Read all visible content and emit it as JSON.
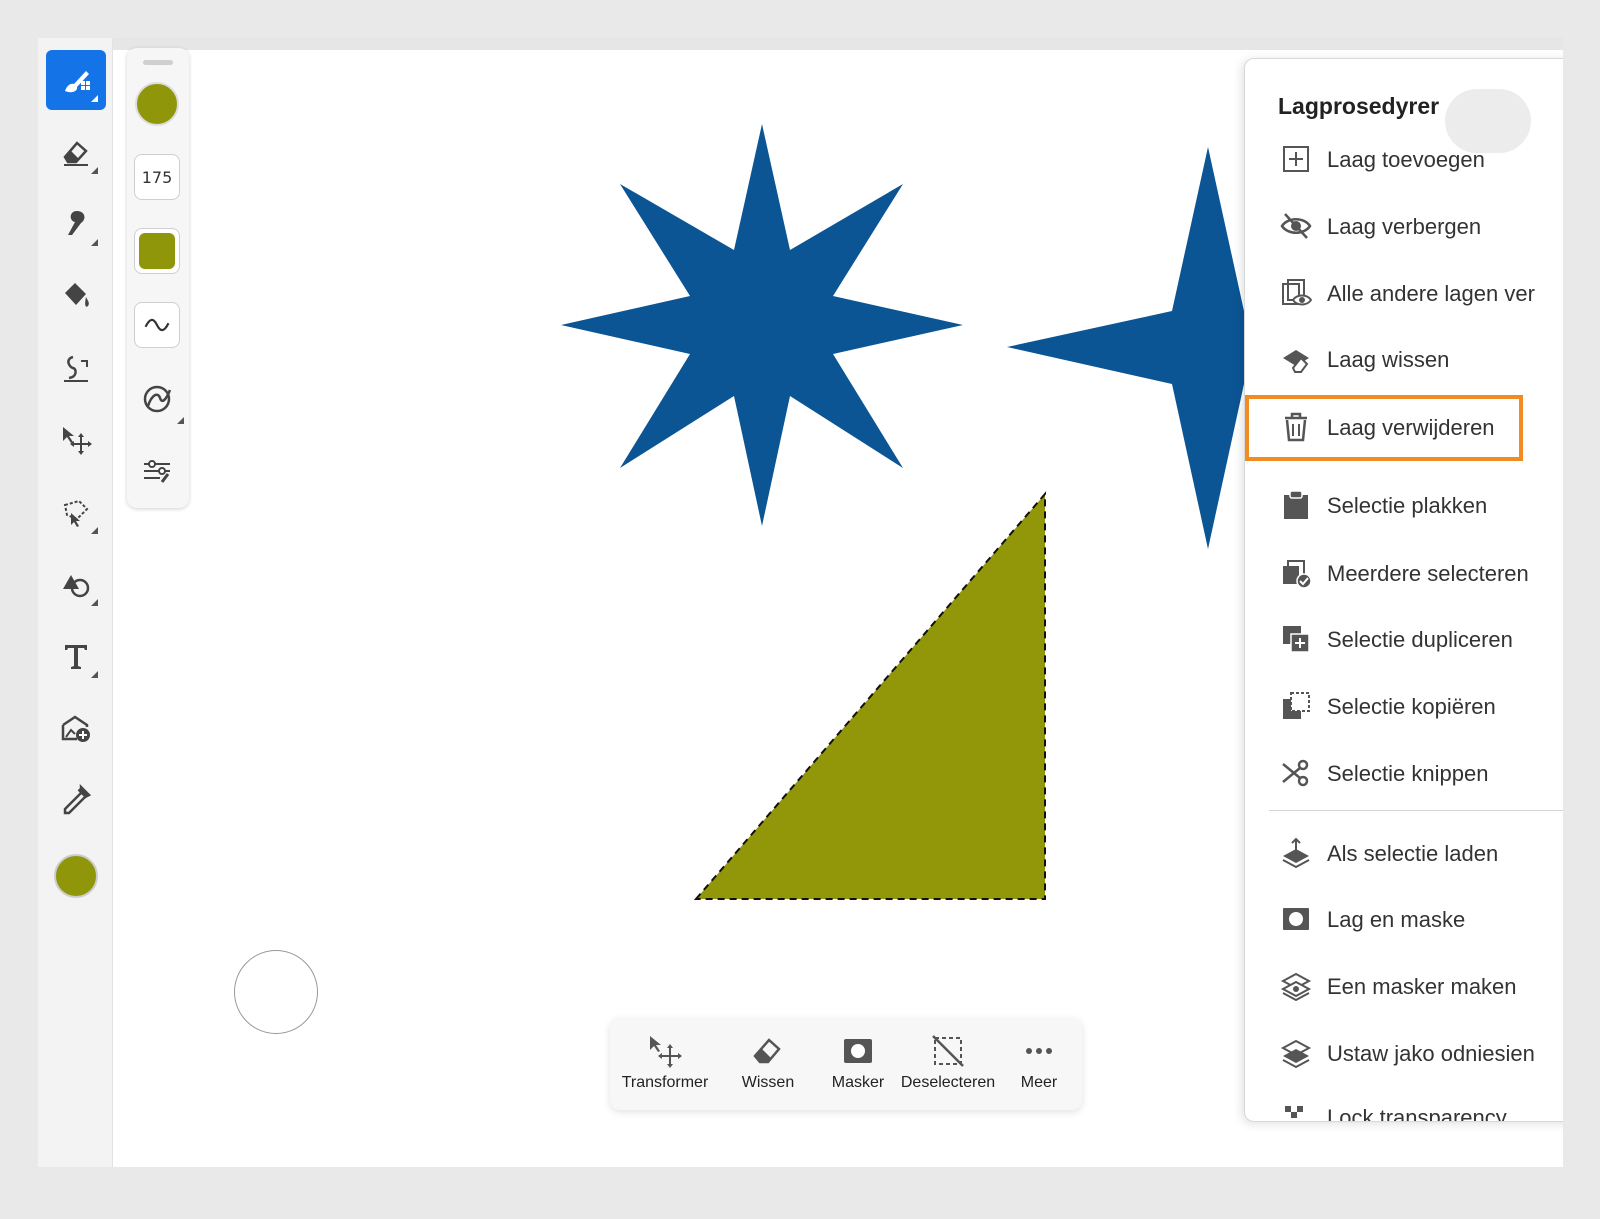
{
  "colors": {
    "active_tool": "#1473e6",
    "brush_color": "#8f9609",
    "shape_blue": "#0b5595",
    "shape_olive": "#919708",
    "highlight": "#f08c22"
  },
  "toolbar": {
    "tools": [
      {
        "name": "brush-tool-icon"
      },
      {
        "name": "eraser-tool-icon"
      },
      {
        "name": "smudge-tool-icon"
      },
      {
        "name": "fill-tool-icon"
      },
      {
        "name": "liquify-tool-icon"
      },
      {
        "name": "move-transform-tool-icon"
      },
      {
        "name": "lasso-selection-tool-icon"
      },
      {
        "name": "shape-tool-icon"
      },
      {
        "name": "text-tool-icon"
      },
      {
        "name": "add-image-tool-icon"
      },
      {
        "name": "eyedropper-tool-icon"
      },
      {
        "name": "color-swatch"
      }
    ]
  },
  "brush_panel": {
    "size": "175"
  },
  "taskbar": {
    "items": [
      {
        "label": "Transformer"
      },
      {
        "label": "Wissen"
      },
      {
        "label": "Masker"
      },
      {
        "label": "Deselecteren"
      },
      {
        "label": "Meer"
      }
    ]
  },
  "menu": {
    "title": "Lagprosedyrer",
    "items": [
      {
        "label": "Laag toevoegen",
        "icon": "add-layer-icon"
      },
      {
        "label": "Laag verbergen",
        "icon": "hide-layer-icon"
      },
      {
        "label": "Alle andere lagen ver",
        "icon": "hide-other-layers-icon"
      },
      {
        "label": "Laag wissen",
        "icon": "clear-layer-icon"
      },
      {
        "label": "Laag verwijderen",
        "icon": "trash-icon"
      },
      {
        "label": "Selectie plakken",
        "icon": "paste-icon"
      },
      {
        "label": "Meerdere selecteren",
        "icon": "select-multiple-icon"
      },
      {
        "label": "Selectie dupliceren",
        "icon": "duplicate-icon"
      },
      {
        "label": "Selectie kopiëren",
        "icon": "copy-selection-icon"
      },
      {
        "label": "Selectie knippen",
        "icon": "scissors-icon"
      },
      {
        "label": "Als selectie laden",
        "icon": "load-selection-icon"
      },
      {
        "label": "Lag en maske",
        "icon": "mask-icon"
      },
      {
        "label": "Een masker maken",
        "icon": "make-mask-icon"
      },
      {
        "label": "Ustaw jako odniesien",
        "icon": "reference-icon"
      },
      {
        "label": "Lock transparency",
        "icon": "lock-transparency-icon"
      }
    ]
  }
}
